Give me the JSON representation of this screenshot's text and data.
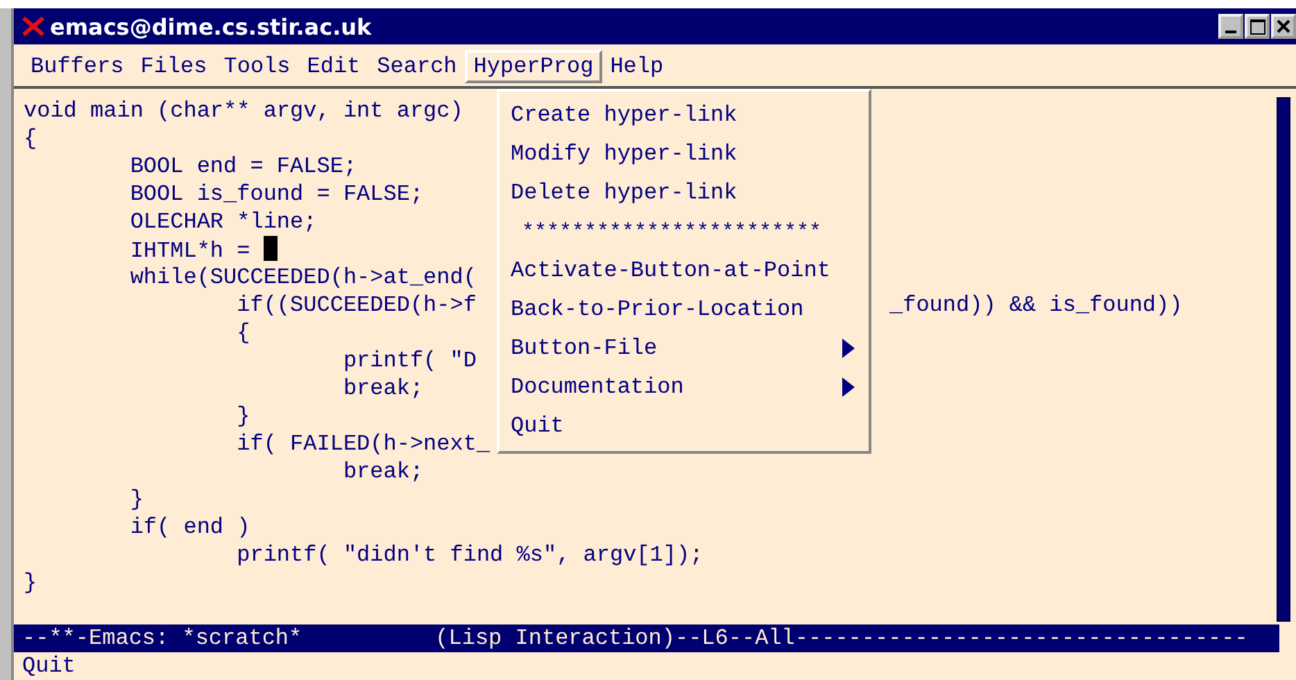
{
  "window": {
    "title": "emacs@dime.cs.stir.ac.uk"
  },
  "menu_bar": [
    {
      "label": "Buffers",
      "selected": false
    },
    {
      "label": "Files",
      "selected": false
    },
    {
      "label": "Tools",
      "selected": false
    },
    {
      "label": "Edit",
      "selected": false
    },
    {
      "label": "Search",
      "selected": false
    },
    {
      "label": "HyperProg",
      "selected": true
    },
    {
      "label": "Help",
      "selected": false
    }
  ],
  "buffer": {
    "lines": [
      {
        "text": "void main (char** argv, int argc)"
      },
      {
        "text": "{"
      },
      {
        "text": "        BOOL end = FALSE;"
      },
      {
        "text": "        BOOL is_found = FALSE;"
      },
      {
        "text": "        OLECHAR *line;"
      },
      {
        "text": "        IHTML*h = ",
        "cursor": true
      },
      {
        "text": "        while(SUCCEEDED(h->at_end("
      },
      {
        "text": "                if((SUCCEEDED(h->f",
        "right_text": "_found)) && is_found))"
      },
      {
        "text": "                {"
      },
      {
        "text": "                        printf( \"D"
      },
      {
        "text": "                        break;"
      },
      {
        "text": "                }"
      },
      {
        "text": "                if( FAILED(h->next_"
      },
      {
        "text": "                        break;"
      },
      {
        "text": "        }"
      },
      {
        "text": "        if( end )"
      },
      {
        "text": "                printf( \"didn't find %s\", argv[1]);"
      },
      {
        "text": "}"
      }
    ]
  },
  "dropdown_menu": {
    "items": [
      {
        "kind": "item",
        "label": "Create hyper-link",
        "submenu": false
      },
      {
        "kind": "item",
        "label": "Modify hyper-link",
        "submenu": false
      },
      {
        "kind": "item",
        "label": "Delete hyper-link",
        "submenu": false
      },
      {
        "kind": "separator",
        "label": "************************"
      },
      {
        "kind": "item",
        "label": "Activate-Button-at-Point",
        "submenu": false
      },
      {
        "kind": "item",
        "label": "Back-to-Prior-Location",
        "submenu": false
      },
      {
        "kind": "item",
        "label": "Button-File",
        "submenu": true
      },
      {
        "kind": "item",
        "label": "Documentation",
        "submenu": true
      },
      {
        "kind": "item",
        "label": "Quit",
        "submenu": false
      }
    ]
  },
  "mode_line": "--**-Emacs: *scratch*          (Lisp Interaction)--L6--All----------------------------------",
  "minibuffer": "Quit"
}
